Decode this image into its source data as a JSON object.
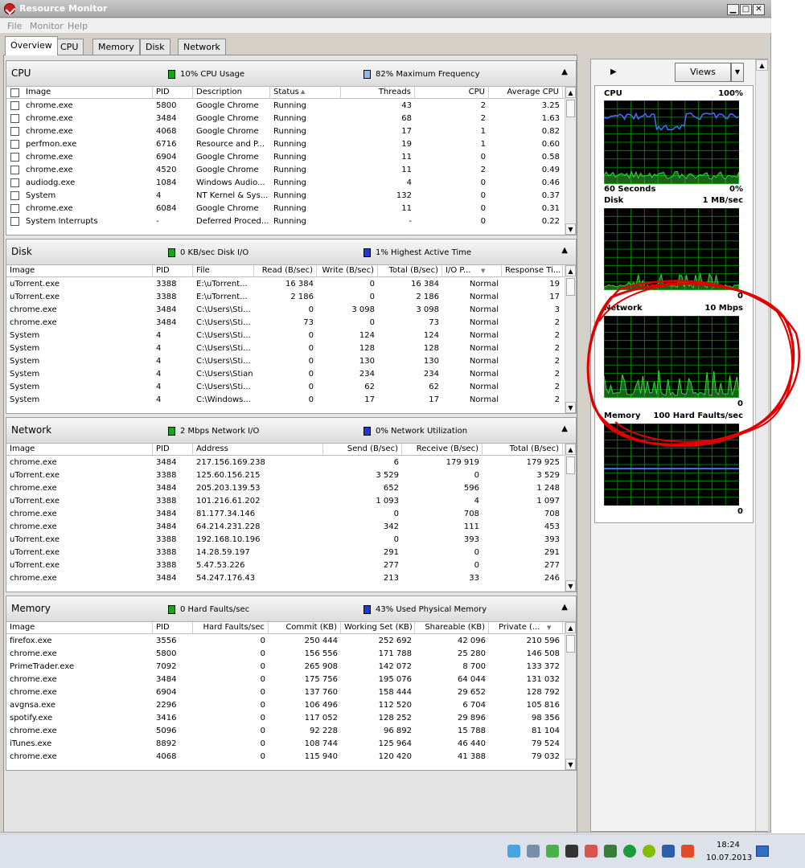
{
  "window": {
    "title": "Resource Monitor",
    "minimize": "▁",
    "maximize": "□",
    "close": "✕"
  },
  "menu": [
    "File",
    "Monitor",
    "Help"
  ],
  "tabs": [
    "Overview",
    "CPU",
    "Memory",
    "Disk",
    "Network"
  ],
  "sections": {
    "cpu": {
      "title": "CPU",
      "stat1": "10% CPU Usage",
      "stat2": "82% Maximum Frequency",
      "columns": [
        "Image",
        "PID",
        "Description",
        "Status",
        "Threads",
        "CPU",
        "Average CPU"
      ],
      "rows": [
        [
          "chrome.exe",
          "5800",
          "Google Chrome",
          "Running",
          "43",
          "2",
          "3.25"
        ],
        [
          "chrome.exe",
          "3484",
          "Google Chrome",
          "Running",
          "68",
          "2",
          "1.63"
        ],
        [
          "chrome.exe",
          "4068",
          "Google Chrome",
          "Running",
          "17",
          "1",
          "0.82"
        ],
        [
          "perfmon.exe",
          "6716",
          "Resource and P...",
          "Running",
          "19",
          "1",
          "0.60"
        ],
        [
          "chrome.exe",
          "6904",
          "Google Chrome",
          "Running",
          "11",
          "0",
          "0.58"
        ],
        [
          "chrome.exe",
          "4520",
          "Google Chrome",
          "Running",
          "11",
          "2",
          "0.49"
        ],
        [
          "audiodg.exe",
          "1084",
          "Windows Audio...",
          "Running",
          "4",
          "0",
          "0.46"
        ],
        [
          "System",
          "4",
          "NT Kernel & Sys...",
          "Running",
          "132",
          "0",
          "0.37"
        ],
        [
          "chrome.exe",
          "6084",
          "Google Chrome",
          "Running",
          "11",
          "0",
          "0.31"
        ],
        [
          "System Interrupts",
          "-",
          "Deferred Proced...",
          "Running",
          "-",
          "0",
          "0.22"
        ]
      ]
    },
    "disk": {
      "title": "Disk",
      "stat1": "0 KB/sec Disk I/O",
      "stat2": "1% Highest Active Time",
      "columns": [
        "Image",
        "PID",
        "File",
        "Read (B/sec)",
        "Write (B/sec)",
        "Total (B/sec)",
        "I/O P...",
        "Response Ti..."
      ],
      "rows": [
        [
          "uTorrent.exe",
          "3388",
          "E:\\uTorrent...",
          "16 384",
          "0",
          "16 384",
          "Normal",
          "19"
        ],
        [
          "uTorrent.exe",
          "3388",
          "E:\\uTorrent...",
          "2 186",
          "0",
          "2 186",
          "Normal",
          "17"
        ],
        [
          "chrome.exe",
          "3484",
          "C:\\Users\\Sti...",
          "0",
          "3 098",
          "3 098",
          "Normal",
          "3"
        ],
        [
          "chrome.exe",
          "3484",
          "C:\\Users\\Sti...",
          "73",
          "0",
          "73",
          "Normal",
          "2"
        ],
        [
          "System",
          "4",
          "C:\\Users\\Sti...",
          "0",
          "124",
          "124",
          "Normal",
          "2"
        ],
        [
          "System",
          "4",
          "C:\\Users\\Sti...",
          "0",
          "128",
          "128",
          "Normal",
          "2"
        ],
        [
          "System",
          "4",
          "C:\\Users\\Sti...",
          "0",
          "130",
          "130",
          "Normal",
          "2"
        ],
        [
          "System",
          "4",
          "C:\\Users\\Stian",
          "0",
          "234",
          "234",
          "Normal",
          "2"
        ],
        [
          "System",
          "4",
          "C:\\Users\\Sti...",
          "0",
          "62",
          "62",
          "Normal",
          "2"
        ],
        [
          "System",
          "4",
          "C:\\Windows...",
          "0",
          "17",
          "17",
          "Normal",
          "2"
        ]
      ]
    },
    "network": {
      "title": "Network",
      "stat1": "2 Mbps Network I/O",
      "stat2": "0% Network Utilization",
      "columns": [
        "Image",
        "PID",
        "Address",
        "Send (B/sec)",
        "Receive (B/sec)",
        "Total (B/sec)"
      ],
      "rows": [
        [
          "chrome.exe",
          "3484",
          "217.156.169.238",
          "6",
          "179 919",
          "179 925"
        ],
        [
          "uTorrent.exe",
          "3388",
          "125.60.156.215",
          "3 529",
          "0",
          "3 529"
        ],
        [
          "chrome.exe",
          "3484",
          "205.203.139.53",
          "652",
          "596",
          "1 248"
        ],
        [
          "uTorrent.exe",
          "3388",
          "101.216.61.202",
          "1 093",
          "4",
          "1 097"
        ],
        [
          "chrome.exe",
          "3484",
          "81.177.34.146",
          "0",
          "708",
          "708"
        ],
        [
          "chrome.exe",
          "3484",
          "64.214.231.228",
          "342",
          "111",
          "453"
        ],
        [
          "uTorrent.exe",
          "3388",
          "192.168.10.196",
          "0",
          "393",
          "393"
        ],
        [
          "uTorrent.exe",
          "3388",
          "14.28.59.197",
          "291",
          "0",
          "291"
        ],
        [
          "uTorrent.exe",
          "3388",
          "5.47.53.226",
          "277",
          "0",
          "277"
        ],
        [
          "chrome.exe",
          "3484",
          "54.247.176.43",
          "213",
          "33",
          "246"
        ]
      ]
    },
    "memory": {
      "title": "Memory",
      "stat1": "0 Hard Faults/sec",
      "stat2": "43% Used Physical Memory",
      "columns": [
        "Image",
        "PID",
        "Hard Faults/sec",
        "Commit (KB)",
        "Working Set (KB)",
        "Shareable (KB)",
        "Private (..."
      ],
      "rows": [
        [
          "firefox.exe",
          "3556",
          "0",
          "250 444",
          "252 692",
          "42 096",
          "210 596"
        ],
        [
          "chrome.exe",
          "5800",
          "0",
          "156 556",
          "171 788",
          "25 280",
          "146 508"
        ],
        [
          "PrimeTrader.exe",
          "7092",
          "0",
          "265 908",
          "142 072",
          "8 700",
          "133 372"
        ],
        [
          "chrome.exe",
          "3484",
          "0",
          "175 756",
          "195 076",
          "64 044",
          "131 032"
        ],
        [
          "chrome.exe",
          "6904",
          "0",
          "137 760",
          "158 444",
          "29 652",
          "128 792"
        ],
        [
          "avgnsa.exe",
          "2296",
          "0",
          "106 496",
          "112 520",
          "6 704",
          "105 816"
        ],
        [
          "spotify.exe",
          "3416",
          "0",
          "117 052",
          "128 252",
          "29 896",
          "98 356"
        ],
        [
          "chrome.exe",
          "5096",
          "0",
          "92 228",
          "96 892",
          "15 788",
          "81 104"
        ],
        [
          "iTunes.exe",
          "8892",
          "0",
          "108 744",
          "125 964",
          "46 440",
          "79 524"
        ],
        [
          "chrome.exe",
          "4068",
          "0",
          "115 940",
          "120 420",
          "41 388",
          "79 032"
        ]
      ]
    }
  },
  "graphs": {
    "views_label": "Views",
    "cpu": {
      "title": "CPU",
      "max": "100%",
      "left_label": "60 Seconds",
      "min": "0%"
    },
    "disk": {
      "title": "Disk",
      "max": "1 MB/sec",
      "min": "0"
    },
    "network": {
      "title": "Network",
      "max": "10 Mbps",
      "min": "0"
    },
    "memory": {
      "title": "Memory",
      "max": "100 Hard Faults/sec",
      "min": "0"
    }
  },
  "taskbar": {
    "time": "18:24",
    "date": "10.07.2013"
  },
  "colors": {
    "graph_bg": "#000000",
    "grid": "#008000",
    "line_green": "#39d639",
    "line_blue": "#4a6cf7",
    "annotation": "#e00000"
  }
}
